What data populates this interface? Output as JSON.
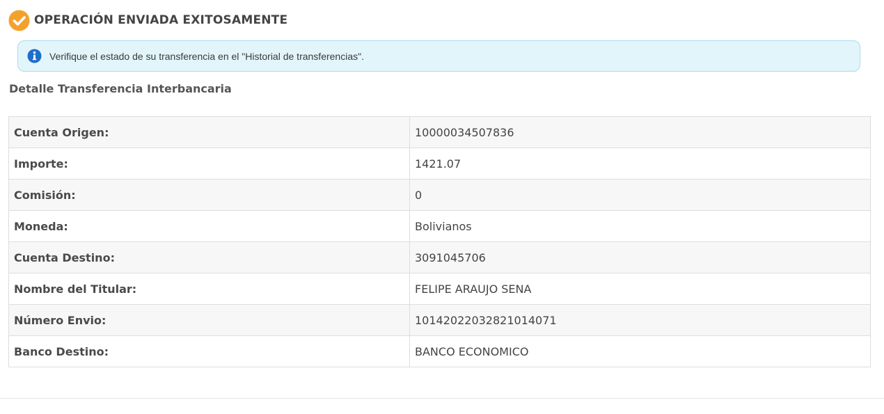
{
  "header": {
    "title": "OPERACIÓN ENVIADA EXITOSAMENTE",
    "icon": "check-circle-icon",
    "icon_color": "#f4a12c"
  },
  "alert": {
    "icon": "info-icon",
    "icon_color": "#1e6fc8",
    "text": "Verifique el estado de su transferencia en el \"Historial de transferencias\"."
  },
  "section": {
    "title": "Detalle Transferencia Interbancaria"
  },
  "details": [
    {
      "label": "Cuenta Origen:",
      "value": "10000034507836"
    },
    {
      "label": "Importe:",
      "value": "1421.07"
    },
    {
      "label": "Comisión:",
      "value": "0"
    },
    {
      "label": "Moneda:",
      "value": "Bolivianos"
    },
    {
      "label": "Cuenta Destino:",
      "value": "3091045706"
    },
    {
      "label": "Nombre del Titular:",
      "value": "FELIPE ARAUJO SENA"
    },
    {
      "label": "Número Envio:",
      "value": "10142022032821014071"
    },
    {
      "label": "Banco Destino:",
      "value": "BANCO ECONOMICO"
    }
  ]
}
